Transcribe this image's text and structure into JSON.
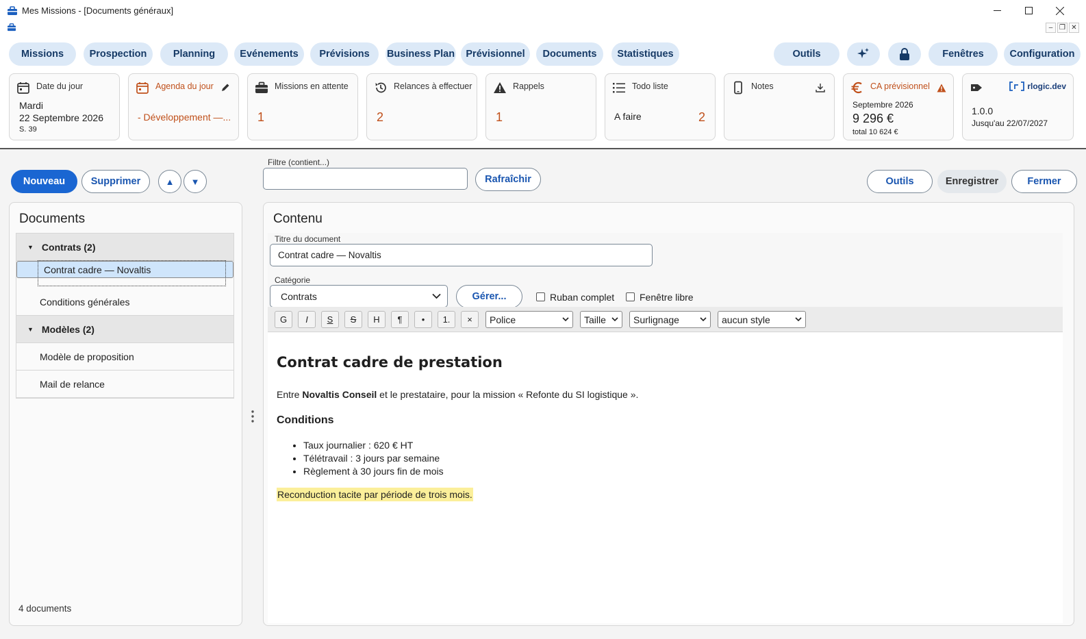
{
  "window": {
    "title": "Mes Missions - [Documents généraux]"
  },
  "nav": {
    "missions": "Missions",
    "prospection": "Prospection",
    "planning": "Planning",
    "evenements": "Evénements",
    "previsions": "Prévisions",
    "business_plan": "Business Plan",
    "previsionnel": "Prévisionnel",
    "documents": "Documents",
    "statistiques": "Statistiques",
    "outils": "Outils",
    "fenetres": "Fenêtres",
    "configuration": "Configuration"
  },
  "cards": {
    "date": {
      "title": "Date du jour",
      "day": "Mardi",
      "date": "22 Septembre 2026",
      "week": "S. 39"
    },
    "agenda": {
      "title": "Agenda du jour",
      "value": "- Développement —..."
    },
    "missions": {
      "title": "Missions en attente",
      "value": "1"
    },
    "relances": {
      "title": "Relances à effectuer",
      "value": "2"
    },
    "rappels": {
      "title": "Rappels",
      "value": "1"
    },
    "todo": {
      "title": "Todo liste",
      "label": "A faire",
      "value": "2"
    },
    "notes": {
      "title": "Notes"
    },
    "ca": {
      "title": "CA prévisionnel",
      "month": "Septembre 2026",
      "amount": "9 296 €",
      "total": "total 10 624 €"
    },
    "license": {
      "brand": "rlogic.dev",
      "version": "1.0.0",
      "until": "Jusqu'au 22/07/2027"
    }
  },
  "toolbar": {
    "nouveau": "Nouveau",
    "supprimer": "Supprimer",
    "filter_label": "Filtre (contient...)",
    "filter_value": "",
    "rafraichir": "Rafraîchir",
    "outils": "Outils",
    "enregistrer": "Enregistrer",
    "fermer": "Fermer"
  },
  "documents": {
    "title": "Documents",
    "groups": [
      {
        "label": "Contrats (2)",
        "items": [
          "Contrat cadre — Novaltis",
          "Conditions générales"
        ]
      },
      {
        "label": "Modèles (2)",
        "items": [
          "Modèle de proposition",
          "Mail de relance"
        ]
      }
    ],
    "count": "4 documents"
  },
  "content": {
    "title": "Contenu",
    "doc_title_label": "Titre du document",
    "doc_title_value": "Contrat cadre — Novaltis",
    "category_label": "Catégorie",
    "category_value": "Contrats",
    "gerer": "Gérer...",
    "ruban": "Ruban complet",
    "fenetre": "Fenêtre libre",
    "format_buttons": [
      "G",
      "I",
      "S",
      "S",
      "H",
      "¶",
      "•",
      "1.",
      "×"
    ],
    "police": "Police",
    "taille": "Taille",
    "surlignage": "Surlignage",
    "style": "aucun style"
  },
  "editor": {
    "heading": "Contrat cadre de prestation",
    "intro_pre": "Entre ",
    "intro_bold": "Novaltis Conseil",
    "intro_post": " et le prestataire, pour la mission « Refonte du SI logistique ».",
    "subheading": "Conditions",
    "bullets": [
      "Taux journalier : 620 € HT",
      "Télétravail : 3 jours par semaine",
      "Règlement à 30 jours fin de mois"
    ],
    "highlight": "Reconduction tacite par période de trois mois."
  },
  "colors": {
    "accent": "#1a66d2",
    "nav_bg": "#dce9f7",
    "orange": "#c0501b",
    "highlight": "#fbef9a"
  }
}
